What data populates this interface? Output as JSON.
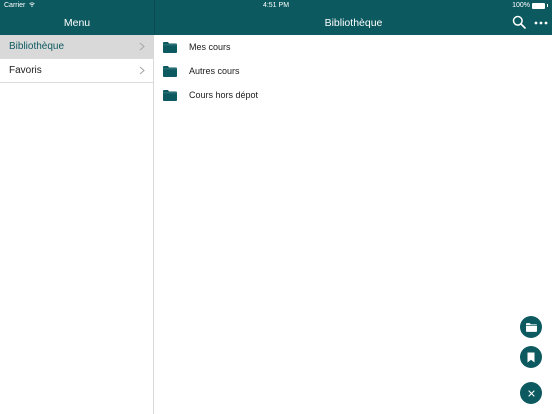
{
  "status_bar": {
    "carrier": "Carrier",
    "time": "4:51 PM",
    "battery": "100%",
    "battery_level": 1.0
  },
  "sidebar": {
    "title": "Menu",
    "items": [
      {
        "label": "Bibliothèque",
        "selected": true
      },
      {
        "label": "Favoris",
        "selected": false
      }
    ]
  },
  "header": {
    "title": "Bibliothèque",
    "icons": [
      "search-icon",
      "more-icon"
    ]
  },
  "main": {
    "folders": [
      {
        "label": "Mes cours",
        "icon": "folder-icon"
      },
      {
        "label": "Autres cours",
        "icon": "folder-icon"
      },
      {
        "label": "Cours hors dépot",
        "icon": "folder-icon"
      }
    ]
  },
  "fabs": {
    "icons": [
      "folder-icon",
      "bookmark-icon",
      "close-icon"
    ]
  },
  "colors": {
    "accent": "#0c5a60",
    "selected_row": "#d9d9d9",
    "divider": "#dcdcdc"
  }
}
